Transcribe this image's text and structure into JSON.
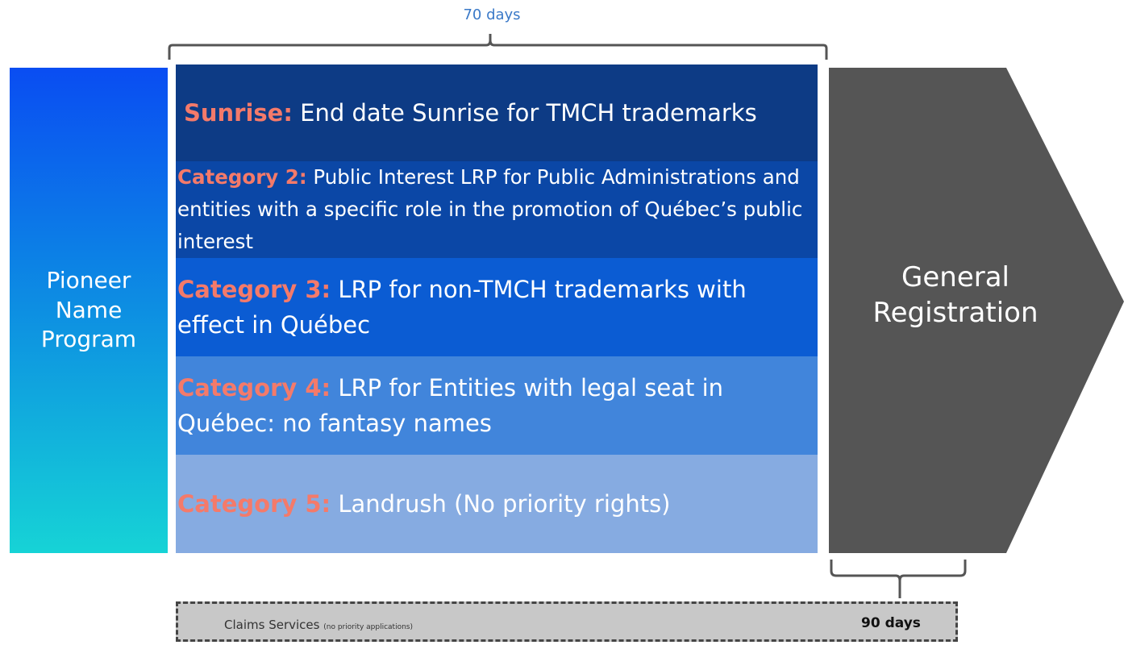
{
  "top_duration": "70 days",
  "pioneer": {
    "lines": [
      "Pioneer",
      "Name",
      "Program"
    ],
    "gradient": [
      "#0a4df2",
      "#16d3d6"
    ]
  },
  "phases": [
    {
      "category": "Sunrise:",
      "text": " End date Sunrise for TMCH trademarks",
      "color": "#0d3b85"
    },
    {
      "category": "Category 2:",
      "text": " Public Interest LRP for Public Administrations and  entities with a specific role in the promotion of Québec’s public interest",
      "color": "#0b47a6"
    },
    {
      "category": "Category 3:",
      "text": " LRP for non-TMCH trademarks with effect in Québec",
      "color": "#0b5cd3"
    },
    {
      "category": "Category 4:",
      "text": " LRP for Entities with legal seat in Québec: no fantasy names",
      "color": "#4185db"
    },
    {
      "category": "Category 5:",
      "text": " Landrush (No priority rights)",
      "color": "#86abe1"
    }
  ],
  "category_color": "#f47a6a",
  "general_registration": {
    "lines": [
      "General",
      "Registration"
    ],
    "color": "#555555"
  },
  "claims": {
    "label": "Claims Services",
    "note": "(no priority applications)",
    "duration": "90 days"
  }
}
